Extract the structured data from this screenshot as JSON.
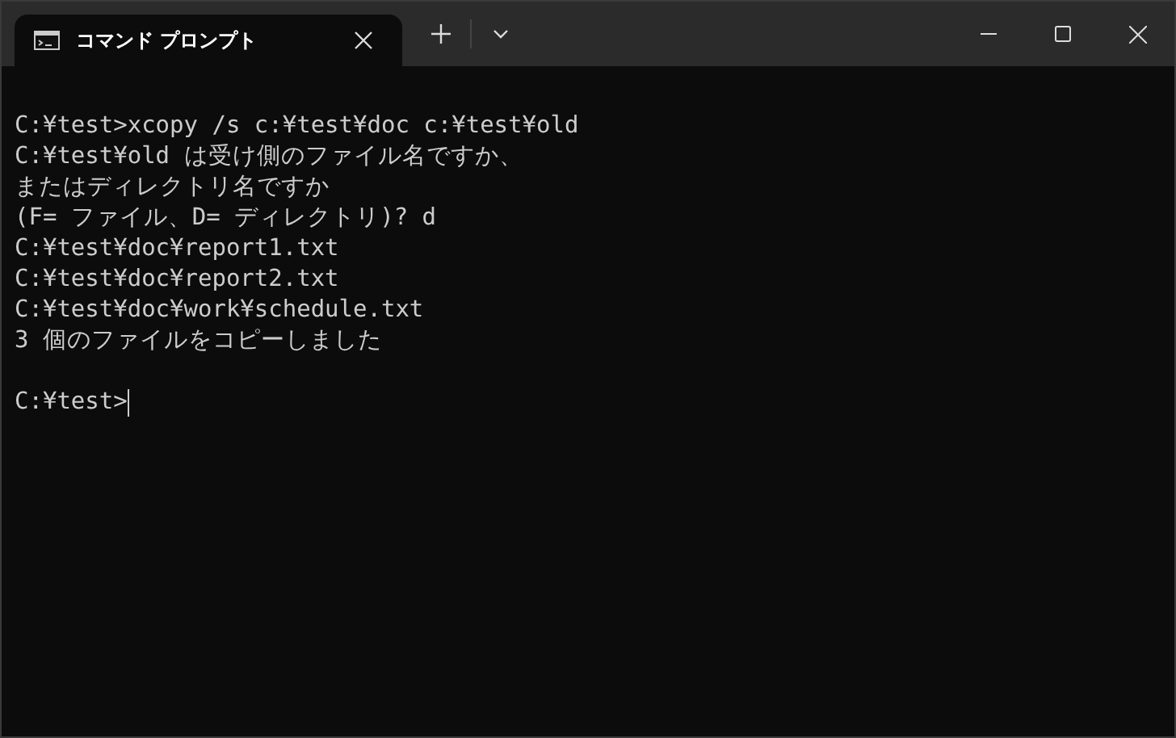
{
  "window": {
    "tab": {
      "title": "コマンド プロンプト",
      "selected": true
    }
  },
  "terminal": {
    "lines": [
      "C:¥test>xcopy /s c:¥test¥doc c:¥test¥old",
      "C:¥test¥old は受け側のファイル名ですか、",
      "またはディレクトリ名ですか",
      "(F= ファイル、D= ディレクトリ)? d",
      "C:¥test¥doc¥report1.txt",
      "C:¥test¥doc¥report2.txt",
      "C:¥test¥doc¥work¥schedule.txt",
      "3 個のファイルをコピーしました"
    ],
    "prompt": "C:¥test>"
  }
}
